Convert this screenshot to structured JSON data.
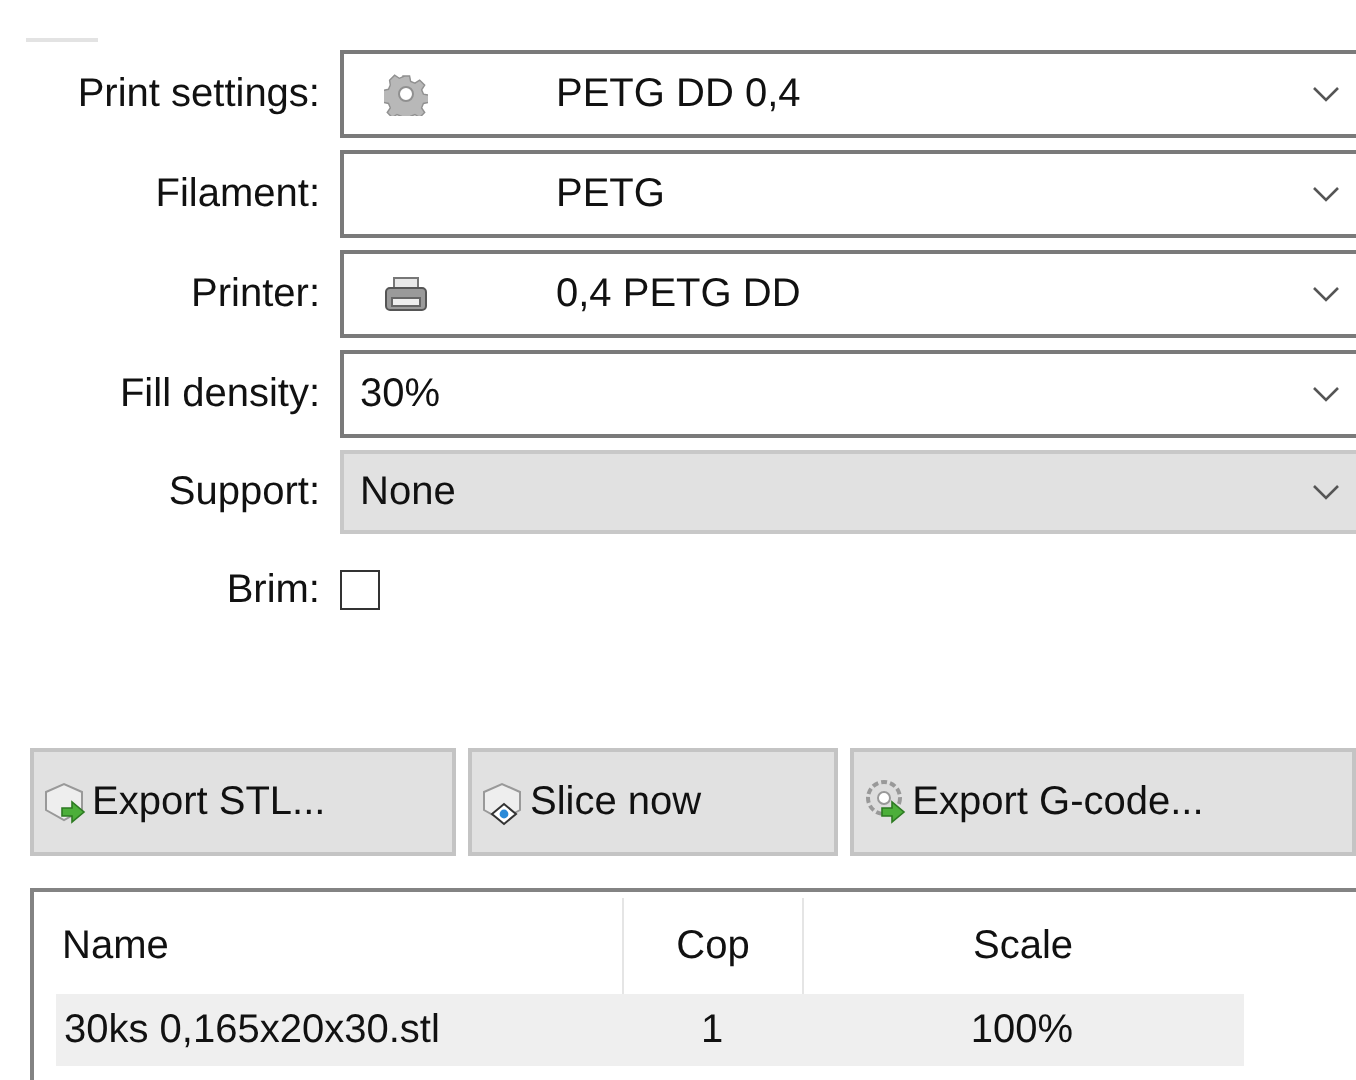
{
  "settings": [
    {
      "label": "Print settings:",
      "kind": "preset",
      "value": "PETG DD 0,4"
    },
    {
      "label": "Filament:",
      "kind": "preset",
      "value": "PETG"
    },
    {
      "label": "Printer:",
      "kind": "preset",
      "value": "0,4 PETG DD"
    },
    {
      "label": "Fill density:",
      "kind": "editable",
      "value": "30%"
    },
    {
      "label": "Support:",
      "kind": "choice",
      "value": "None"
    }
  ],
  "brim": {
    "label": "Brim:",
    "checked": false
  },
  "buttons": [
    {
      "label": "Export STL..."
    },
    {
      "label": "Slice now"
    },
    {
      "label": "Export G-code..."
    }
  ],
  "table": {
    "columns": [
      "Name",
      "Cop",
      "Scale"
    ],
    "rows": [
      {
        "cells": [
          "30ks 0,165x20x30.stl",
          "1",
          "100%"
        ]
      }
    ]
  }
}
